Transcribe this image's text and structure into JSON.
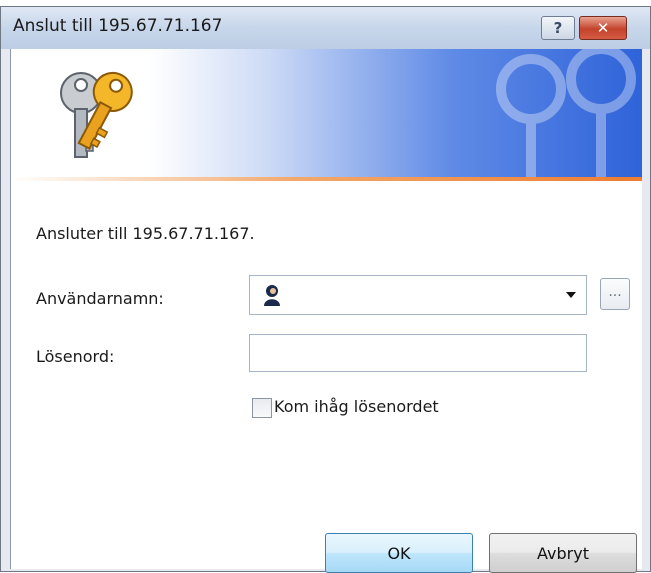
{
  "window": {
    "title": "Anslut till 195.67.71.167",
    "help_glyph": "?",
    "close_glyph": "✕"
  },
  "body": {
    "connecting_text": "Ansluter till 195.67.71.167.",
    "username_label": "Användarnamn:",
    "username_value": "",
    "browse_label": "...",
    "password_label": "Lösenord:",
    "password_value": "",
    "remember_label": "Kom ihåg lösenordet",
    "remember_checked": false
  },
  "buttons": {
    "ok_label": "OK",
    "cancel_label": "Avbryt"
  },
  "icons": {
    "banner": "keys-icon",
    "user": "user-icon",
    "dropdown": "chevron-down-icon"
  },
  "colors": {
    "banner_blue": "#2f63d9",
    "accent_orange": "#ee7d31",
    "ok_border": "#3c7fb1"
  }
}
